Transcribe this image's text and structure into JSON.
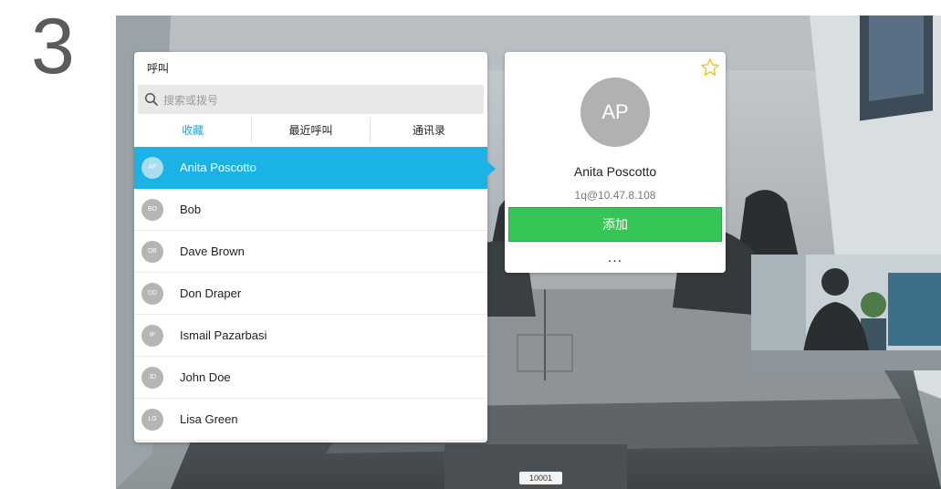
{
  "step": {
    "number": "3"
  },
  "call_panel": {
    "title": "呼叫",
    "search": {
      "placeholder": "搜索或拨号"
    },
    "tabs": [
      {
        "label": "收藏",
        "active": true
      },
      {
        "label": "最近呼叫",
        "active": false
      },
      {
        "label": "通讯录",
        "active": false
      }
    ],
    "contacts": [
      {
        "initials": "AP",
        "name": "Anita Poscotto",
        "selected": true
      },
      {
        "initials": "BO",
        "name": "Bob",
        "selected": false
      },
      {
        "initials": "DB",
        "name": "Dave Brown",
        "selected": false
      },
      {
        "initials": "DD",
        "name": "Don Draper",
        "selected": false
      },
      {
        "initials": "IP",
        "name": "Ismail Pazarbasi",
        "selected": false
      },
      {
        "initials": "JD",
        "name": "John Doe",
        "selected": false
      },
      {
        "initials": "LG",
        "name": "Lisa Green",
        "selected": false
      }
    ]
  },
  "detail": {
    "initials": "AP",
    "name": "Anita Poscotto",
    "address": "1q@10.47.8.108",
    "add_label": "添加",
    "more_label": "...",
    "star_icon": "star-outline-icon"
  },
  "footer": {
    "number": "10001"
  },
  "colors": {
    "accent": "#1bb3e6",
    "add_green": "#35c657",
    "star": "#f5c518"
  }
}
